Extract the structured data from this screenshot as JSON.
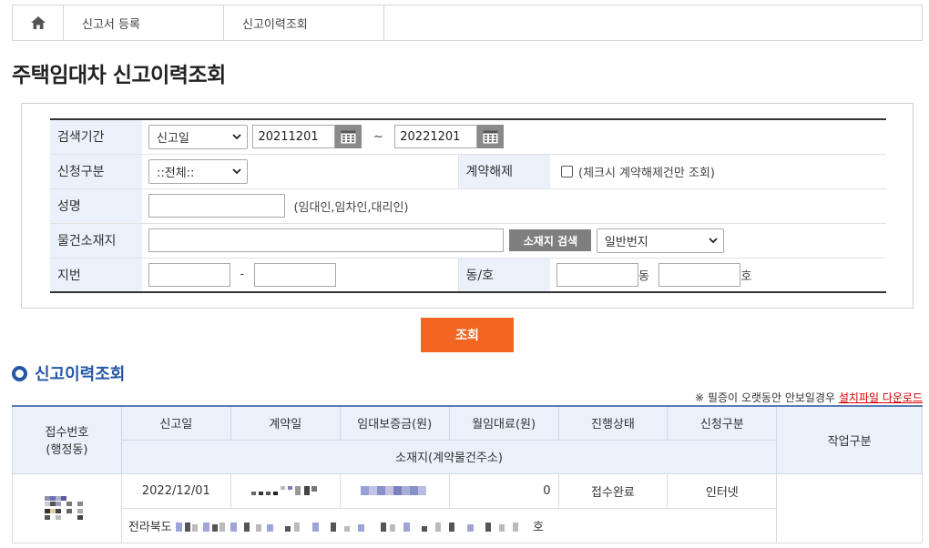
{
  "breadcrumb": {
    "item1": "신고서 등록",
    "item2": "신고이력조회"
  },
  "page_title": "주택임대차 신고이력조회",
  "search": {
    "period_label": "검색기간",
    "period_type": "신고일",
    "date_from": "20211201",
    "tilde": "~",
    "date_to": "20221201",
    "apply_type_label": "신청구분",
    "apply_type_value": "::전체::",
    "cancel_label": "계약해제",
    "cancel_hint": "(체크시 계약해제건만 조회)",
    "name_label": "성명",
    "name_hint": "(임대인,임차인,대리인)",
    "location_label": "물건소재지",
    "location_button": "소재지 검색",
    "lot_type": "일반번지",
    "lot_label": "지번",
    "dash": "-",
    "dongho_label": "동/호",
    "dong_suffix": "동",
    "ho_suffix": "호"
  },
  "query_button": "조회",
  "section_title": "신고이력조회",
  "notice": {
    "text": "※ 필증이 오랫동안 안보일경우",
    "link": "설치파일 다운로드"
  },
  "result": {
    "headers": {
      "receipt_no": "접수번호",
      "receipt_sub": "(행정동)",
      "report_date": "신고일",
      "contract_date": "계약일",
      "deposit": "임대보증금(원)",
      "monthly_rent": "월임대료(원)",
      "status": "진행상태",
      "apply_type": "신청구분",
      "location": "소재지(계약물건주소)",
      "work": "작업구분"
    },
    "row": {
      "report_date": "2022/12/01",
      "monthly_rent": "0",
      "status": "접수완료",
      "apply_type": "인터넷",
      "address_prefix": "전라북도",
      "address_suffix": "호"
    }
  },
  "icons": [
    "home-icon",
    "calendar-icon",
    "chevron-down-icon",
    "ring-icon"
  ]
}
